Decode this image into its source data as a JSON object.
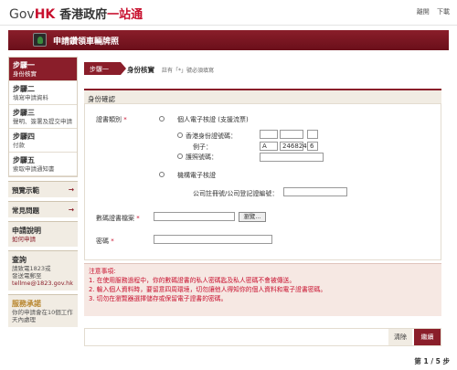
{
  "header": {
    "logo_gov": "Gov",
    "logo_hk": "HK",
    "logo_zh": "香港政府",
    "logo_zh2": "一站通",
    "links": [
      "離開",
      "下載"
    ]
  },
  "banner": {
    "title": "申請鑽領車輛牌照"
  },
  "sidebar": {
    "steps": [
      {
        "num": "步驟一",
        "desc": "身份核實"
      },
      {
        "num": "步驟二",
        "desc": "填寫申請資料"
      },
      {
        "num": "步驟三",
        "desc": "聲明、簽署及提交申請"
      },
      {
        "num": "步驟四",
        "desc": "付款"
      },
      {
        "num": "步驟五",
        "desc": "索取申請通知書"
      }
    ],
    "links": [
      {
        "label": "預覽示範"
      },
      {
        "label": "常見問題"
      }
    ],
    "help": {
      "title": "申請說明",
      "sub": "如何申請"
    },
    "enquiry": {
      "title": "查詢",
      "line1": "請致電1823或",
      "line2": "發送電郵至",
      "email": "tellme@1823.gov.hk"
    },
    "promise": {
      "title": "服務承諾",
      "text": "你的申請會在10個工作天內處理"
    }
  },
  "crumb": {
    "step": "步驟一",
    "current": "身份核實",
    "note": "註有「*」號必須填寫"
  },
  "form": {
    "section": "身份確認",
    "cert_type_label": "證書類別",
    "opt_personal": "個人電子核證 (支援流票)",
    "opt_hkid": "香港身份證號碼：",
    "example_label": "例子：",
    "example_letter": "A",
    "example_num": "246824",
    "example_check": "6",
    "opt_passport": "護照號碼：",
    "opt_org": "機構電子核證",
    "company_label": "公司註冊號/公司登記證編號：",
    "cert_file_label": "數碼證書檔案",
    "browse_label": "瀏覽...",
    "password_label": "密碼",
    "required": "*"
  },
  "notice": {
    "title": "注意事項:",
    "items": [
      "1.  在使用服務過程中，你的數碼證書的私人密碼匙及私人密碼不會被傳送。",
      "2.  輸入個人資料時，要留意四周環境，切勿讓他人得知你的個人資料和電子證書密碼。",
      "3.  切勿在瀏覽器選擇儲存或保留電子證書的密碼。"
    ]
  },
  "actions": {
    "clear": "清除",
    "next": "繼續"
  },
  "pager": {
    "text": "第 1 / 5 步"
  },
  "colors": {
    "brand": "#8a1e2a",
    "accent_red": "#c8102e",
    "panel_bg": "#f1ece3"
  }
}
